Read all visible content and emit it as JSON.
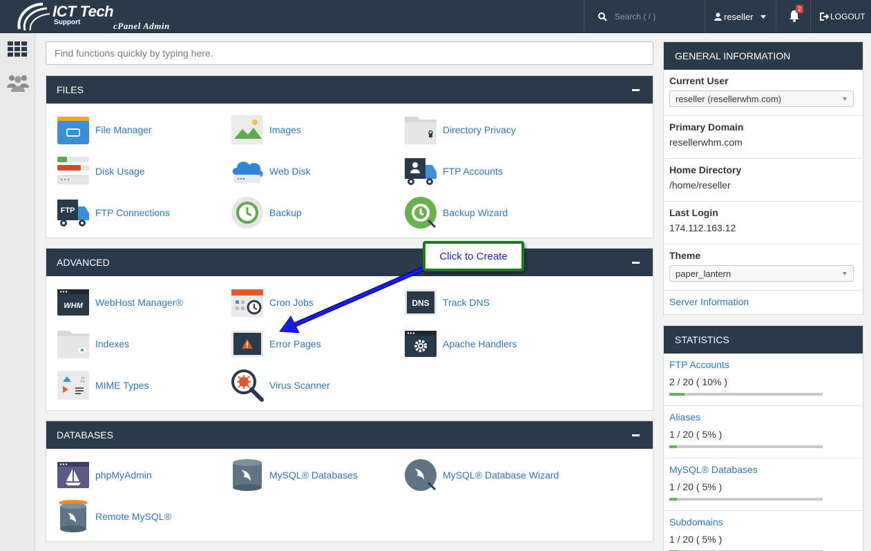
{
  "header": {
    "logo_title": "ICT Tech",
    "logo_subtitle": "Support",
    "logo_tagline": "cPanel Admin",
    "search_placeholder": "Search ( / )",
    "user": "reseller",
    "notification_count": "2",
    "logout": "LOGOUT"
  },
  "quick_search": {
    "placeholder": "Find functions quickly by typing here."
  },
  "files": {
    "title": "FILES",
    "items": [
      "File Manager",
      "Images",
      "Directory Privacy",
      "Disk Usage",
      "Web Disk",
      "FTP Accounts",
      "FTP Connections",
      "Backup",
      "Backup Wizard"
    ]
  },
  "advanced": {
    "title": "ADVANCED",
    "items": [
      "WebHost Manager®",
      "Cron Jobs",
      "Track DNS",
      "Indexes",
      "Error Pages",
      "Apache Handlers",
      "MIME Types",
      "Virus Scanner"
    ]
  },
  "databases": {
    "title": "DATABASES",
    "items": [
      "phpMyAdmin",
      "MySQL® Databases",
      "MySQL® Database Wizard",
      "Remote MySQL®"
    ]
  },
  "icon_text": {
    "whm": "WHM",
    "dns": "DNS",
    "ftp": "FTP"
  },
  "annotation": {
    "text": "Click to Create",
    "arrow_color": "#1010d0",
    "border_color": "#1e7a1e"
  },
  "general_info": {
    "title": "GENERAL INFORMATION",
    "current_user_label": "Current User",
    "current_user_value": "reseller (resellerwhm.com)",
    "primary_domain_label": "Primary Domain",
    "primary_domain_value": "resellerwhm.com",
    "home_directory_label": "Home Directory",
    "home_directory_value": "/home/reseller",
    "last_login_label": "Last Login",
    "last_login_value": "174.112.163.12",
    "theme_label": "Theme",
    "theme_value": "paper_lantern",
    "server_info_link": "Server Information"
  },
  "statistics": {
    "title": "STATISTICS",
    "rows": [
      {
        "label": "FTP Accounts",
        "value": "2 / 20 ( 10% )",
        "fraction": 0.1
      },
      {
        "label": "Aliases",
        "value": "1 / 20 ( 5% )",
        "fraction": 0.05
      },
      {
        "label": "MySQL® Databases",
        "value": "1 / 20 ( 5% )",
        "fraction": 0.05
      },
      {
        "label": "Subdomains",
        "value": "1 / 20 ( 5% )",
        "fraction": 0.05
      }
    ]
  },
  "colors": {
    "header_bg": "#293a4a",
    "link": "#2e76b8",
    "progress": "#5cb85c"
  }
}
